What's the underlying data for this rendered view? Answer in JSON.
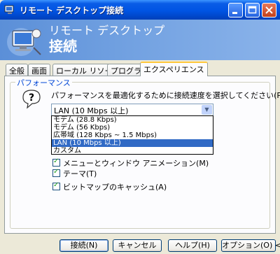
{
  "window": {
    "title": "リモート デスクトップ接続",
    "banner_line1": "リモート デスクトップ",
    "banner_line2": "接続"
  },
  "tabs": [
    {
      "label": "全般"
    },
    {
      "label": "画面"
    },
    {
      "label": "ローカル リソース"
    },
    {
      "label": "プログラム"
    },
    {
      "label": "エクスペリエンス",
      "active": true
    }
  ],
  "performance": {
    "group_label": "パフォーマンス",
    "prompt": "パフォーマンスを最適化するために接続速度を選択してください(P)",
    "selected_value": "LAN (10 Mbps 以上)",
    "options": [
      "モデム (28.8 Kbps)",
      "モデム (56 Kbps)",
      "広帯域 (128 Kbps ~ 1.5 Mbps)",
      "LAN (10 Mbps 以上)",
      "カスタム"
    ],
    "selected_index": 3
  },
  "checkboxes": [
    {
      "label": "メニューとウィンドウ アニメーション(M)",
      "checked": true
    },
    {
      "label": "テーマ(T)",
      "checked": true
    },
    {
      "label": "ビットマップのキャッシュ(A)",
      "checked": true
    }
  ],
  "buttons": {
    "connect": "接続(N)",
    "cancel": "キャンセル",
    "help": "ヘルプ(H)",
    "options": "オプション(O) <<"
  },
  "colors": {
    "titlebar": "#0054e3",
    "selection": "#316ac5",
    "group_label": "#0046d5"
  }
}
